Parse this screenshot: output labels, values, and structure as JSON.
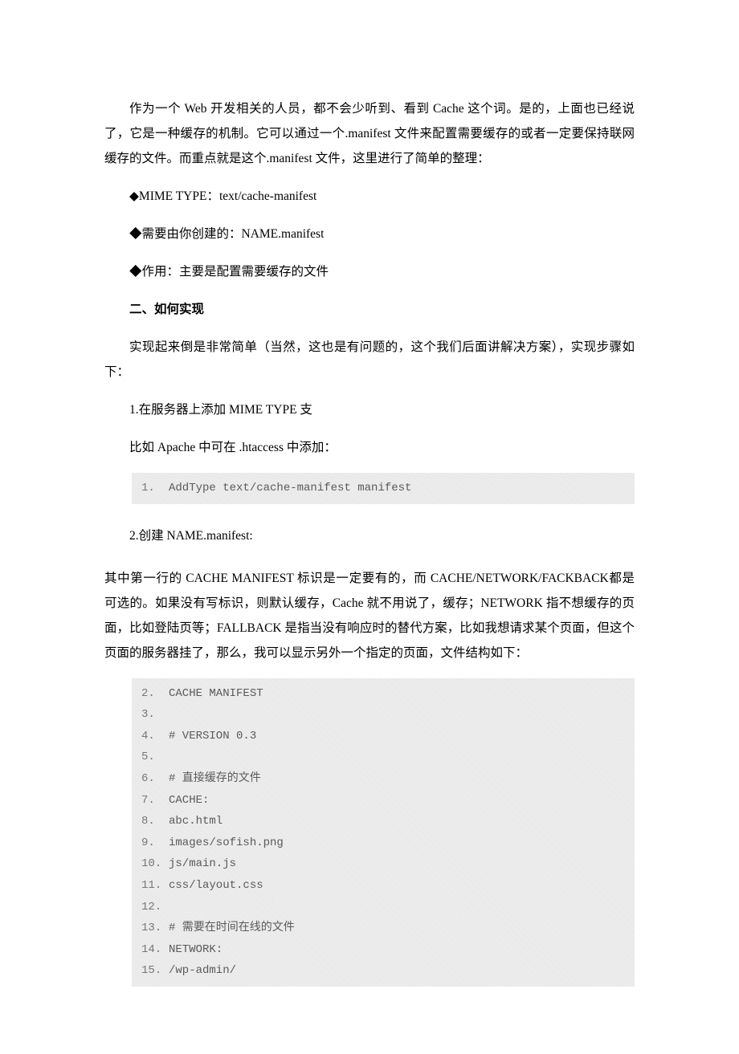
{
  "p1": "作为一个 Web 开发相关的人员，都不会少听到、看到 Cache 这个词。是的，上面也已经说了，它是一种缓存的机制。它可以通过一个.manifest 文件来配置需要缓存的或者一定要保持联网缓存的文件。而重点就是这个.manifest 文件，这里进行了简单的整理：",
  "b1": "◆MIME TYPE：text/cache-manifest",
  "b2": "◆需要由你创建的：NAME.manifest",
  "b3": "◆作用：主要是配置需要缓存的文件",
  "h2": "二、如何实现",
  "p2": "实现起来倒是非常简单（当然，这也是有问题的，这个我们后面讲解决方案），实现步骤如下：",
  "s1": "1.在服务器上添加 MIME TYPE 支",
  "s1a": "比如 Apache 中可在 .htaccess 中添加：",
  "code1": [
    {
      "n": "1.",
      "t": "AddType text/cache-manifest manifest"
    }
  ],
  "s2": "2.创建 NAME.manifest:",
  "p3": "其中第一行的 CACHE MANIFEST 标识是一定要有的，而 CACHE/NETWORK/FACKBACK都是可选的。如果没有写标识，则默认缓存，Cache 就不用说了，缓存；NETWORK 指不想缓存的页面，比如登陆页等；FALLBACK 是指当没有响应时的替代方案，比如我想请求某个页面，但这个页面的服务器挂了，那么，我可以显示另外一个指定的页面，文件结构如下：",
  "code2": [
    {
      "n": "2.",
      "t": "CACHE MANIFEST"
    },
    {
      "n": "3.",
      "t": ""
    },
    {
      "n": "4.",
      "t": "# VERSION 0.3"
    },
    {
      "n": "5.",
      "t": ""
    },
    {
      "n": "6.",
      "t": "# 直接缓存的文件"
    },
    {
      "n": "7.",
      "t": "CACHE:"
    },
    {
      "n": "8.",
      "t": "abc.html"
    },
    {
      "n": "9.",
      "t": "images/sofish.png"
    },
    {
      "n": "10.",
      "t": "js/main.js"
    },
    {
      "n": "11.",
      "t": "css/layout.css"
    },
    {
      "n": "12.",
      "t": ""
    },
    {
      "n": "13.",
      "t": "# 需要在时间在线的文件"
    },
    {
      "n": "14.",
      "t": "NETWORK:"
    },
    {
      "n": "15.",
      "t": "/wp-admin/"
    }
  ]
}
